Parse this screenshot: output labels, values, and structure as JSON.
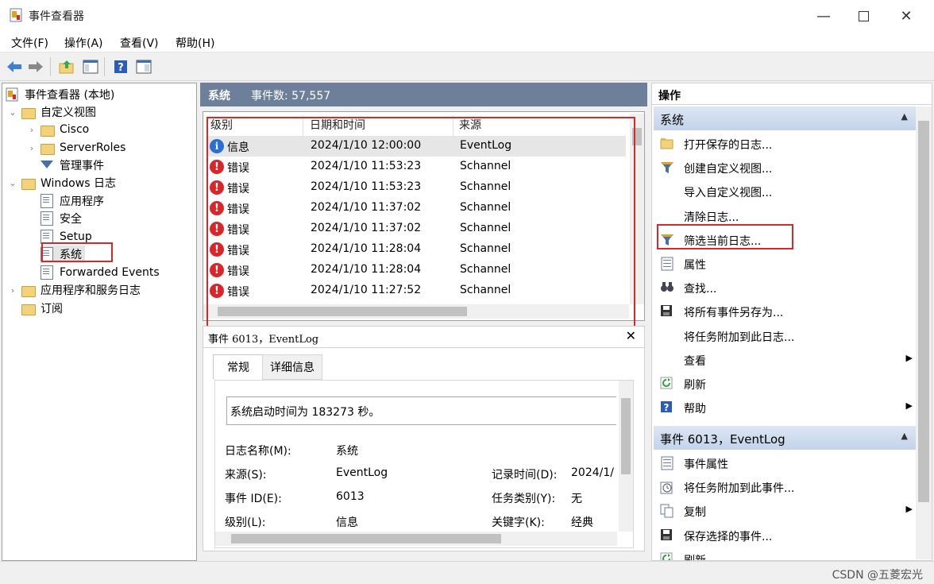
{
  "window": {
    "title": "事件查看器"
  },
  "menubar": [
    "文件(F)",
    "操作(A)",
    "查看(V)",
    "帮助(H)"
  ],
  "tree": {
    "root": "事件查看器 (本地)",
    "custom_views": "自定义视图",
    "cisco": "Cisco",
    "serverroles": "ServerRoles",
    "admin_events": "管理事件",
    "windows_logs": "Windows 日志",
    "application": "应用程序",
    "security": "安全",
    "setup": "Setup",
    "system": "系统",
    "forwarded": "Forwarded Events",
    "app_service_logs": "应用程序和服务日志",
    "subscriptions": "订阅"
  },
  "center": {
    "log_name": "系统",
    "event_count": "事件数: 57,557"
  },
  "list": {
    "headers": [
      "级别",
      "日期和时间",
      "来源"
    ],
    "rows": [
      {
        "level": "信息",
        "type": "info",
        "datetime": "2024/1/10 12:00:00",
        "source": "EventLog"
      },
      {
        "level": "错误",
        "type": "error",
        "datetime": "2024/1/10 11:53:23",
        "source": "Schannel"
      },
      {
        "level": "错误",
        "type": "error",
        "datetime": "2024/1/10 11:53:23",
        "source": "Schannel"
      },
      {
        "level": "错误",
        "type": "error",
        "datetime": "2024/1/10 11:37:02",
        "source": "Schannel"
      },
      {
        "level": "错误",
        "type": "error",
        "datetime": "2024/1/10 11:37:02",
        "source": "Schannel"
      },
      {
        "level": "错误",
        "type": "error",
        "datetime": "2024/1/10 11:28:04",
        "source": "Schannel"
      },
      {
        "level": "错误",
        "type": "error",
        "datetime": "2024/1/10 11:28:04",
        "source": "Schannel"
      },
      {
        "level": "错误",
        "type": "error",
        "datetime": "2024/1/10 11:27:52",
        "source": "Schannel"
      }
    ]
  },
  "detail": {
    "title": "事件 6013，EventLog",
    "tab_general": "常规",
    "tab_details": "详细信息",
    "message": "系统启动时间为 183273 秒。",
    "log_name_label": "日志名称(M):",
    "log_name_value": "系统",
    "source_label": "来源(S):",
    "source_value": "EventLog",
    "logged_label": "记录时间(D):",
    "logged_value": "2024/1/",
    "event_id_label": "事件 ID(E):",
    "event_id_value": "6013",
    "task_label": "任务类别(Y):",
    "task_value": "无",
    "level_label": "级别(L):",
    "level_value": "信息",
    "keywords_label": "关键字(K):",
    "keywords_value": "经典"
  },
  "actions": {
    "header": "操作",
    "section1": "系统",
    "items1": [
      {
        "label": "打开保存的日志...",
        "icon": "open-folder-icon"
      },
      {
        "label": "创建自定义视图...",
        "icon": "filter-icon"
      },
      {
        "label": "导入自定义视图...",
        "icon": ""
      },
      {
        "label": "清除日志...",
        "icon": ""
      },
      {
        "label": "筛选当前日志...",
        "icon": "filter-icon"
      },
      {
        "label": "属性",
        "icon": "properties-icon"
      },
      {
        "label": "查找...",
        "icon": "binoculars-icon"
      },
      {
        "label": "将所有事件另存为...",
        "icon": "save-icon"
      },
      {
        "label": "将任务附加到此日志...",
        "icon": ""
      },
      {
        "label": "查看",
        "icon": "",
        "submenu": true
      },
      {
        "label": "刷新",
        "icon": "refresh-icon"
      },
      {
        "label": "帮助",
        "icon": "help-icon",
        "submenu": true
      }
    ],
    "section2": "事件 6013，EventLog",
    "items2": [
      {
        "label": "事件属性",
        "icon": "properties-icon"
      },
      {
        "label": "将任务附加到此事件...",
        "icon": "task-icon"
      },
      {
        "label": "复制",
        "icon": "copy-icon",
        "submenu": true
      },
      {
        "label": "保存选择的事件...",
        "icon": "save-icon"
      },
      {
        "label": "刷新",
        "icon": "refresh-icon"
      }
    ]
  },
  "watermark": "CSDN @五菱宏光",
  "colors": {
    "header_bar": "#6d7f99",
    "highlight_box": "#d32b2b",
    "section_header": "#c3d3ea"
  }
}
